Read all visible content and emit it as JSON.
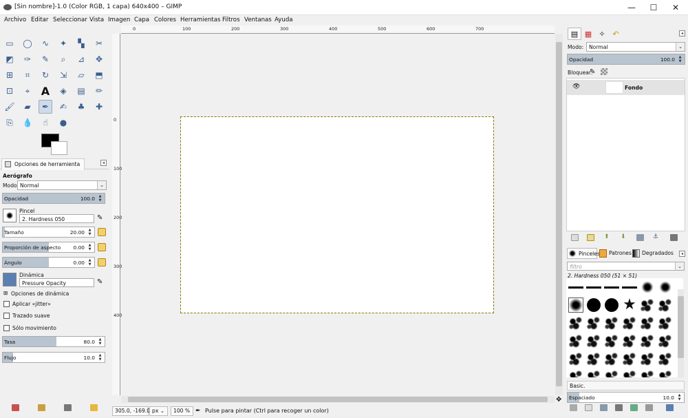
{
  "window": {
    "title": "[Sin nombre]-1.0 (Color RGB, 1 capa) 640x400 – GIMP",
    "minimize": "—",
    "maximize": "☐",
    "close": "✕"
  },
  "menu": [
    "Archivo",
    "Editar",
    "Seleccionar",
    "Vista",
    "Imagen",
    "Capa",
    "Colores",
    "Herramientas",
    "Filtros",
    "Ventanas",
    "Ayuda"
  ],
  "toolbox": {
    "tools": [
      "rect-select-icon",
      "ellipse-select-icon",
      "free-select-icon",
      "fuzzy-select-icon",
      "color-select-icon",
      "scissors-select-icon",
      "foreground-select-icon",
      "paths-icon",
      "color-picker-icon",
      "zoom-icon",
      "measure-icon",
      "move-icon",
      "align-icon",
      "crop-icon",
      "rotate-icon",
      "scale-icon",
      "shear-icon",
      "perspective-icon",
      "unified-transform-icon",
      "handle-transform-icon",
      "text-icon",
      "bucket-fill-icon",
      "blend-icon",
      "pencil-icon",
      "paintbrush-icon",
      "eraser-icon",
      "airbrush-icon",
      "ink-icon",
      "mypaint-brush-icon",
      "heal-icon",
      "clone-icon",
      "blur-icon",
      "smudge-icon",
      "dodge-burn-icon"
    ],
    "active_tool": "airbrush-icon",
    "fg_color": "#000000",
    "bg_color": "#ffffff"
  },
  "tool_options": {
    "tab_label": "Opciones de herramienta",
    "tool_name": "Aerógrafo",
    "mode_label": "Modo:",
    "mode_value": "Normal",
    "opacity_label": "Opacidad",
    "opacity_value": "100.0",
    "opacity_fraction": 1.0,
    "brush_label": "Pincel",
    "brush_value": "2. Hardness 050",
    "size_label": "Tamaño",
    "size_value": "20.00",
    "size_fraction": 0.02,
    "aspect_label": "Proporción de aspecto",
    "aspect_value": "0.00",
    "aspect_fraction": 0.5,
    "angle_label": "Ángulo",
    "angle_value": "0.00",
    "angle_fraction": 0.5,
    "dynamics_label": "Dinámica",
    "dynamics_value": "Pressure Opacity",
    "dynamics_options_label": "Opciones de dinámica",
    "jitter_label": "Aplicar «jitter»",
    "smooth_label": "Trazado suave",
    "motion_only_label": "Sólo movimiento",
    "rate_label": "Tasa",
    "rate_value": "80.0",
    "rate_fraction": 0.53,
    "flow_label": "Flujo",
    "flow_value": "10.0",
    "flow_fraction": 0.1
  },
  "canvas": {
    "ruler_h": [
      "0",
      "100",
      "200",
      "300",
      "400",
      "500",
      "600",
      "700"
    ],
    "ruler_v": [
      "0",
      "100",
      "200",
      "300",
      "400"
    ],
    "image_width": 640,
    "image_height": 400
  },
  "status": {
    "coords": "305.0, -169.0",
    "unit": "px",
    "zoom": "100 %",
    "message": "Pulse para pintar (Ctrl para recoger un color)"
  },
  "layers": {
    "mode_label": "Modo:",
    "mode_value": "Normal",
    "opacity_label": "Opacidad",
    "opacity_value": "100.0",
    "opacity_fraction": 1.0,
    "lock_label": "Bloquear:",
    "layer_name": "Fondo"
  },
  "brushes": {
    "tabs": [
      "Pinceles",
      "Patrones",
      "Degradados"
    ],
    "filter_placeholder": "filtro",
    "selected_brush": "2. Hardness 050 (51 × 51)",
    "preset": "Basic.",
    "spacing_label": "Espaciado",
    "spacing_value": "10.0",
    "spacing_fraction": 0.1
  }
}
